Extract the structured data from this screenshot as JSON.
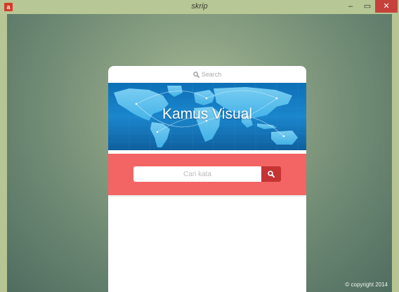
{
  "window": {
    "title": "skrip",
    "app_icon_glyph": "a",
    "minimize_glyph": "–",
    "maximize_glyph": "▭",
    "close_glyph": "✕"
  },
  "card": {
    "search_label": "Search",
    "banner_title": "Kamus Visual",
    "input_placeholder": "Cari kata"
  },
  "footer": {
    "copyright": "© copyright 2014"
  },
  "colors": {
    "accent_red": "#f36464",
    "button_red": "#c53333",
    "banner_blue": "#1a86cc",
    "close_red": "#c6413c"
  },
  "icons": [
    "app-icon",
    "search-icon",
    "magnifier-icon",
    "world-map-icon"
  ]
}
